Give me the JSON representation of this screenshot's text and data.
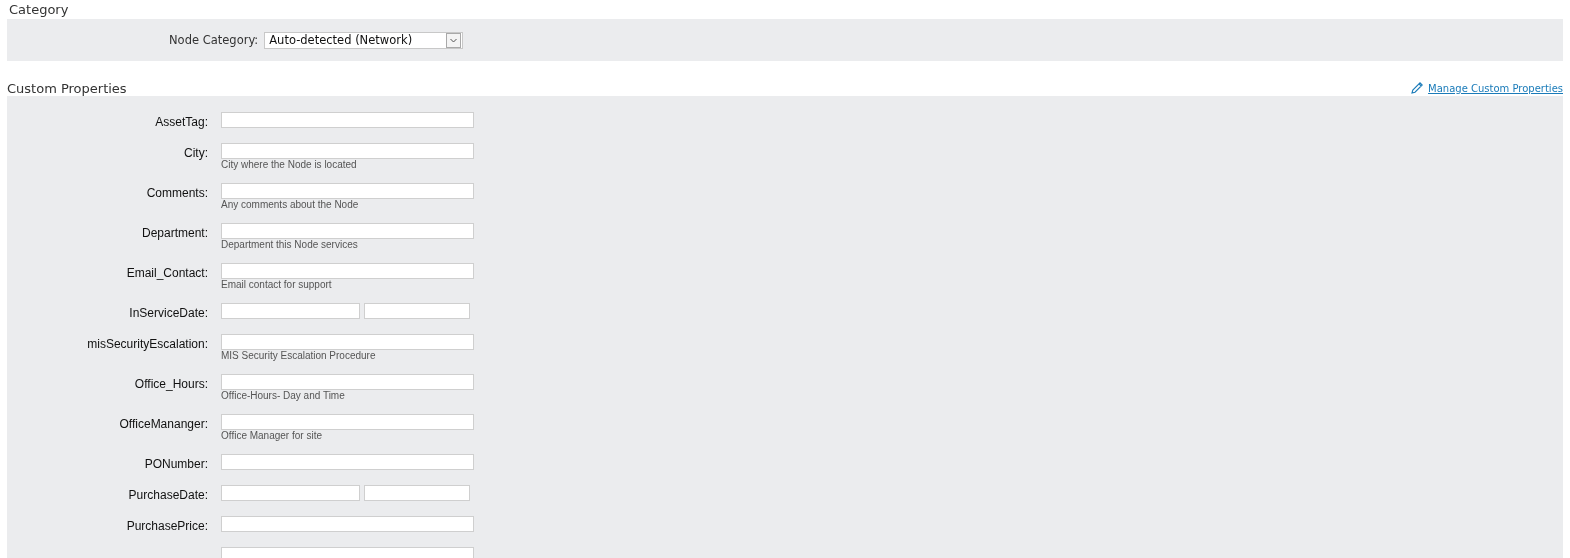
{
  "category": {
    "title": "Category",
    "label": "Node Category:",
    "value": "Auto-detected (Network)"
  },
  "custom_properties": {
    "title": "Custom Properties",
    "manage_link": "Manage Custom Properties",
    "fields": [
      {
        "kind": "text",
        "label": "AssetTag:"
      },
      {
        "kind": "text",
        "label": "City:",
        "hint": "City where the Node is located"
      },
      {
        "kind": "text",
        "label": "Comments:",
        "hint": "Any comments about the Node"
      },
      {
        "kind": "text",
        "label": "Department:",
        "hint": "Department this Node services"
      },
      {
        "kind": "text",
        "label": "Email_Contact:",
        "hint": "Email contact for support"
      },
      {
        "kind": "date",
        "label": "InServiceDate:"
      },
      {
        "kind": "text",
        "label": "misSecurityEscalation:",
        "hint": "MIS Security Escalation Procedure"
      },
      {
        "kind": "text",
        "label": "Office_Hours:",
        "hint": "Office-Hours- Day and Time"
      },
      {
        "kind": "text",
        "label": "OfficeMananger:",
        "hint": "Office Manager for site"
      },
      {
        "kind": "text",
        "label": "PONumber:"
      },
      {
        "kind": "date",
        "label": "PurchaseDate:"
      },
      {
        "kind": "text",
        "label": "PurchasePrice:"
      },
      {
        "kind": "text"
      }
    ]
  }
}
